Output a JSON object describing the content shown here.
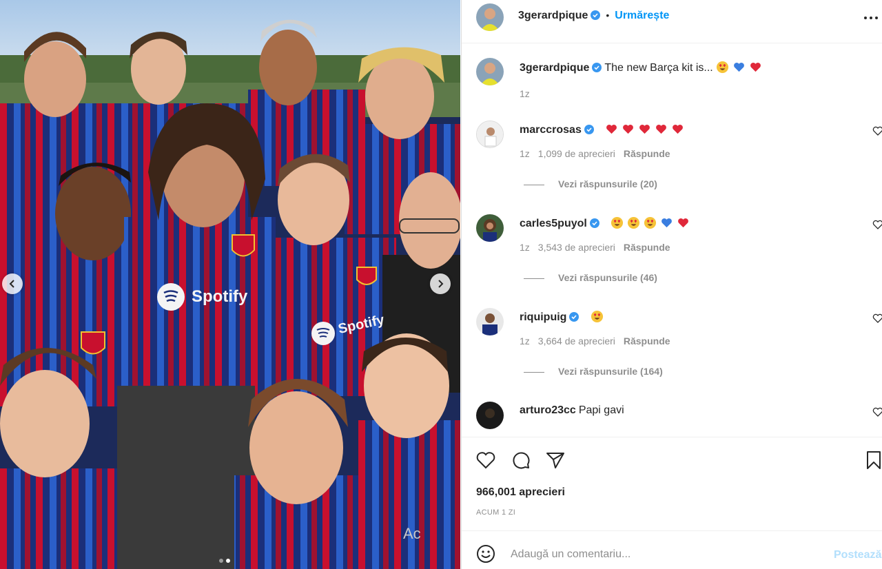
{
  "post": {
    "author": "3gerardpique",
    "follow_label": "Urmărește",
    "caption_user": "3gerardpique",
    "caption_text": "The new Barça kit is...",
    "caption_time": "1z",
    "likes": "966,001 aprecieri",
    "timestamp": "ACUM 1 ZI"
  },
  "photo": {
    "jersey_sponsor_1": "Spotify",
    "jersey_sponsor_2": "Spotify",
    "slide_count": 2,
    "active_slide": 2
  },
  "comments": [
    {
      "user": "marccrosas",
      "text": "",
      "emojis": [
        "heart-red",
        "heart-red",
        "heart-red",
        "heart-red",
        "heart-red"
      ],
      "time": "1z",
      "likes": "1,099 de aprecieri",
      "reply": "Răspunde",
      "view_replies": "Vezi răspunsurile (20)"
    },
    {
      "user": "carles5puyol",
      "text": "",
      "emojis": [
        "heart-eyes",
        "heart-eyes",
        "heart-eyes",
        "heart-blue",
        "heart-red"
      ],
      "time": "1z",
      "likes": "3,543 de aprecieri",
      "reply": "Răspunde",
      "view_replies": "Vezi răspunsurile (46)"
    },
    {
      "user": "riquipuig",
      "text": "",
      "emojis": [
        "heart-eyes"
      ],
      "time": "1z",
      "likes": "3,664 de aprecieri",
      "reply": "Răspunde",
      "view_replies": "Vezi răspunsurile (164)"
    },
    {
      "user": "arturo23cc",
      "text": "Papi gavi",
      "emojis": [],
      "time": "",
      "likes": "",
      "reply": "",
      "view_replies": ""
    }
  ],
  "comment_box": {
    "placeholder": "Adaugă un comentariu...",
    "post_label": "Postează"
  },
  "overlay": {
    "ghost_text": "Ac"
  },
  "colors": {
    "accent": "#0095f6",
    "barca_blue": "#1b3a8c",
    "barca_red": "#c8102e",
    "verified": "#3897f0"
  }
}
